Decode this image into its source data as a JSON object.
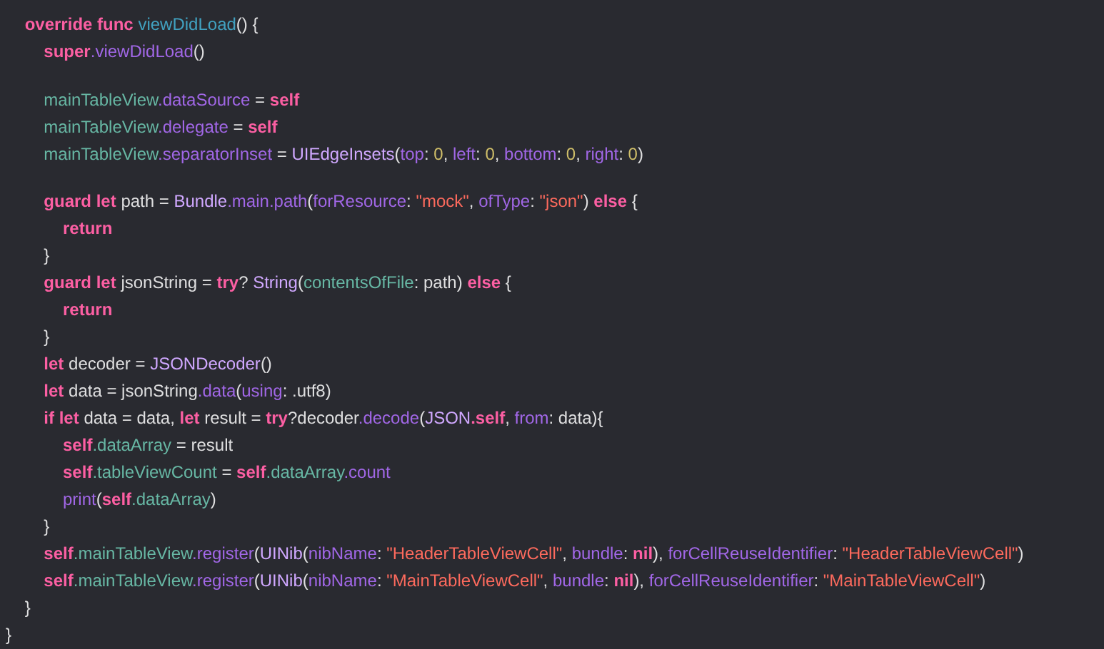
{
  "editor": {
    "lines": [
      {
        "kind": "code",
        "tokens": [
          {
            "text": "    override func ",
            "kind": "keyword"
          },
          {
            "text": "viewDidLoad",
            "kind": "declaration"
          },
          {
            "text": "() {",
            "kind": "plain"
          }
        ]
      },
      {
        "kind": "code",
        "tokens": [
          {
            "text": "        super",
            "kind": "keyword"
          },
          {
            "text": ".viewDidLoad",
            "kind": "system"
          },
          {
            "text": "()",
            "kind": "plain"
          }
        ]
      },
      {
        "kind": "blank"
      },
      {
        "kind": "code",
        "tokens": [
          {
            "text": "        mainTableView",
            "kind": "project"
          },
          {
            "text": ".dataSource",
            "kind": "system"
          },
          {
            "text": " = ",
            "kind": "plain"
          },
          {
            "text": "self",
            "kind": "keyword"
          }
        ]
      },
      {
        "kind": "code",
        "tokens": [
          {
            "text": "        mainTableView",
            "kind": "project"
          },
          {
            "text": ".delegate",
            "kind": "system"
          },
          {
            "text": " = ",
            "kind": "plain"
          },
          {
            "text": "self",
            "kind": "keyword"
          }
        ]
      },
      {
        "kind": "code",
        "tokens": [
          {
            "text": "        mainTableView",
            "kind": "project"
          },
          {
            "text": ".separatorInset",
            "kind": "system"
          },
          {
            "text": " = ",
            "kind": "plain"
          },
          {
            "text": "UIEdgeInsets",
            "kind": "type"
          },
          {
            "text": "(",
            "kind": "plain"
          },
          {
            "text": "top",
            "kind": "system"
          },
          {
            "text": ": ",
            "kind": "plain"
          },
          {
            "text": "0",
            "kind": "number"
          },
          {
            "text": ", ",
            "kind": "plain"
          },
          {
            "text": "left",
            "kind": "system"
          },
          {
            "text": ": ",
            "kind": "plain"
          },
          {
            "text": "0",
            "kind": "number"
          },
          {
            "text": ", ",
            "kind": "plain"
          },
          {
            "text": "bottom",
            "kind": "system"
          },
          {
            "text": ": ",
            "kind": "plain"
          },
          {
            "text": "0",
            "kind": "number"
          },
          {
            "text": ", ",
            "kind": "plain"
          },
          {
            "text": "right",
            "kind": "system"
          },
          {
            "text": ": ",
            "kind": "plain"
          },
          {
            "text": "0",
            "kind": "number"
          },
          {
            "text": ")",
            "kind": "plain"
          }
        ]
      },
      {
        "kind": "blank"
      },
      {
        "kind": "code",
        "tokens": [
          {
            "text": "        guard let ",
            "kind": "keyword"
          },
          {
            "text": "path = ",
            "kind": "plain"
          },
          {
            "text": "Bundle",
            "kind": "type"
          },
          {
            "text": ".main.path",
            "kind": "system"
          },
          {
            "text": "(",
            "kind": "plain"
          },
          {
            "text": "forResource",
            "kind": "system"
          },
          {
            "text": ": ",
            "kind": "plain"
          },
          {
            "text": "\"mock\"",
            "kind": "string"
          },
          {
            "text": ", ",
            "kind": "plain"
          },
          {
            "text": "ofType",
            "kind": "system"
          },
          {
            "text": ": ",
            "kind": "plain"
          },
          {
            "text": "\"json\"",
            "kind": "string"
          },
          {
            "text": ") ",
            "kind": "plain"
          },
          {
            "text": "else",
            "kind": "keyword"
          },
          {
            "text": " {",
            "kind": "plain"
          }
        ]
      },
      {
        "kind": "code",
        "tokens": [
          {
            "text": "            return",
            "kind": "keyword"
          }
        ]
      },
      {
        "kind": "code",
        "tokens": [
          {
            "text": "        }",
            "kind": "plain"
          }
        ]
      },
      {
        "kind": "code",
        "tokens": [
          {
            "text": "        guard let ",
            "kind": "keyword"
          },
          {
            "text": "jsonString = ",
            "kind": "plain"
          },
          {
            "text": "try",
            "kind": "keyword"
          },
          {
            "text": "? ",
            "kind": "plain"
          },
          {
            "text": "String",
            "kind": "type"
          },
          {
            "text": "(",
            "kind": "plain"
          },
          {
            "text": "contentsOfFile",
            "kind": "project"
          },
          {
            "text": ": path) ",
            "kind": "plain"
          },
          {
            "text": "else",
            "kind": "keyword"
          },
          {
            "text": " {",
            "kind": "plain"
          }
        ]
      },
      {
        "kind": "code",
        "tokens": [
          {
            "text": "            return",
            "kind": "keyword"
          }
        ]
      },
      {
        "kind": "code",
        "tokens": [
          {
            "text": "        }",
            "kind": "plain"
          }
        ]
      },
      {
        "kind": "code",
        "tokens": [
          {
            "text": "        let ",
            "kind": "keyword"
          },
          {
            "text": "decoder = ",
            "kind": "plain"
          },
          {
            "text": "JSONDecoder",
            "kind": "type"
          },
          {
            "text": "()",
            "kind": "plain"
          }
        ]
      },
      {
        "kind": "code",
        "tokens": [
          {
            "text": "        let ",
            "kind": "keyword"
          },
          {
            "text": "data = jsonString",
            "kind": "plain"
          },
          {
            "text": ".data",
            "kind": "system"
          },
          {
            "text": "(",
            "kind": "plain"
          },
          {
            "text": "using",
            "kind": "system"
          },
          {
            "text": ": .utf8)",
            "kind": "plain"
          }
        ]
      },
      {
        "kind": "code",
        "tokens": [
          {
            "text": "        if let ",
            "kind": "keyword"
          },
          {
            "text": "data = data, ",
            "kind": "plain"
          },
          {
            "text": "let ",
            "kind": "keyword"
          },
          {
            "text": "result = ",
            "kind": "plain"
          },
          {
            "text": "try",
            "kind": "keyword"
          },
          {
            "text": "?decoder",
            "kind": "plain"
          },
          {
            "text": ".decode",
            "kind": "system"
          },
          {
            "text": "(",
            "kind": "plain"
          },
          {
            "text": "JSON",
            "kind": "type"
          },
          {
            "text": ".self",
            "kind": "keyword"
          },
          {
            "text": ", ",
            "kind": "plain"
          },
          {
            "text": "from",
            "kind": "system"
          },
          {
            "text": ": data){",
            "kind": "plain"
          }
        ]
      },
      {
        "kind": "code",
        "tokens": [
          {
            "text": "            self",
            "kind": "keyword"
          },
          {
            "text": ".dataArray",
            "kind": "project"
          },
          {
            "text": " = result",
            "kind": "plain"
          }
        ]
      },
      {
        "kind": "code",
        "tokens": [
          {
            "text": "            self",
            "kind": "keyword"
          },
          {
            "text": ".tableViewCount",
            "kind": "project"
          },
          {
            "text": " = ",
            "kind": "plain"
          },
          {
            "text": "self",
            "kind": "keyword"
          },
          {
            "text": ".dataArray",
            "kind": "project"
          },
          {
            "text": ".count",
            "kind": "system"
          }
        ]
      },
      {
        "kind": "code",
        "tokens": [
          {
            "text": "            print",
            "kind": "system"
          },
          {
            "text": "(",
            "kind": "plain"
          },
          {
            "text": "self",
            "kind": "keyword"
          },
          {
            "text": ".dataArray",
            "kind": "project"
          },
          {
            "text": ")",
            "kind": "plain"
          }
        ]
      },
      {
        "kind": "code",
        "tokens": [
          {
            "text": "        }",
            "kind": "plain"
          }
        ]
      },
      {
        "kind": "code",
        "tokens": [
          {
            "text": "        self",
            "kind": "keyword"
          },
          {
            "text": ".mainTableView",
            "kind": "project"
          },
          {
            "text": ".register",
            "kind": "system"
          },
          {
            "text": "(",
            "kind": "plain"
          },
          {
            "text": "UINib",
            "kind": "type"
          },
          {
            "text": "(",
            "kind": "plain"
          },
          {
            "text": "nibName",
            "kind": "system"
          },
          {
            "text": ": ",
            "kind": "plain"
          },
          {
            "text": "\"HeaderTableViewCell\"",
            "kind": "string"
          },
          {
            "text": ", ",
            "kind": "plain"
          },
          {
            "text": "bundle",
            "kind": "system"
          },
          {
            "text": ": ",
            "kind": "plain"
          },
          {
            "text": "nil",
            "kind": "keyword"
          },
          {
            "text": "), ",
            "kind": "plain"
          },
          {
            "text": "forCellReuseIdentifier",
            "kind": "system"
          },
          {
            "text": ": ",
            "kind": "plain"
          },
          {
            "text": "\"HeaderTableViewCell\"",
            "kind": "string"
          },
          {
            "text": ")",
            "kind": "plain"
          }
        ]
      },
      {
        "kind": "code",
        "tokens": [
          {
            "text": "        self",
            "kind": "keyword"
          },
          {
            "text": ".mainTableView",
            "kind": "project"
          },
          {
            "text": ".register",
            "kind": "system"
          },
          {
            "text": "(",
            "kind": "plain"
          },
          {
            "text": "UINib",
            "kind": "type"
          },
          {
            "text": "(",
            "kind": "plain"
          },
          {
            "text": "nibName",
            "kind": "system"
          },
          {
            "text": ": ",
            "kind": "plain"
          },
          {
            "text": "\"MainTableViewCell\"",
            "kind": "string"
          },
          {
            "text": ", ",
            "kind": "plain"
          },
          {
            "text": "bundle",
            "kind": "system"
          },
          {
            "text": ": ",
            "kind": "plain"
          },
          {
            "text": "nil",
            "kind": "keyword"
          },
          {
            "text": "), ",
            "kind": "plain"
          },
          {
            "text": "forCellReuseIdentifier",
            "kind": "system"
          },
          {
            "text": ": ",
            "kind": "plain"
          },
          {
            "text": "\"MainTableViewCell\"",
            "kind": "string"
          },
          {
            "text": ")",
            "kind": "plain"
          }
        ]
      },
      {
        "kind": "code",
        "tokens": [
          {
            "text": "    }",
            "kind": "plain"
          }
        ]
      },
      {
        "kind": "code",
        "tokens": [
          {
            "text": "}",
            "kind": "plain"
          }
        ]
      }
    ]
  }
}
